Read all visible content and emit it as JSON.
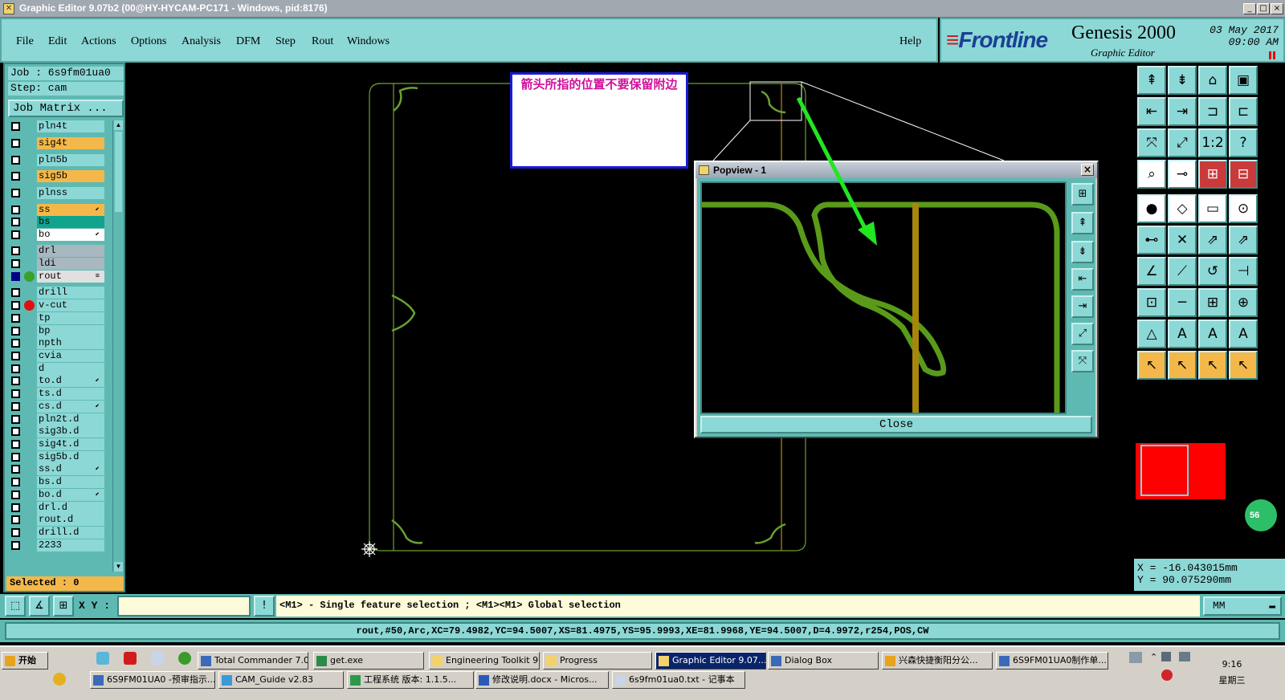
{
  "window": {
    "title": "Graphic Editor 9.07b2 (00@HY-HYCAM-PC171 - Windows, pid:8176)",
    "minimize": "_",
    "maximize": "□",
    "close": "×"
  },
  "menu": [
    "File",
    "Edit",
    "Actions",
    "Options",
    "Analysis",
    "DFM",
    "Step",
    "Rout",
    "Windows"
  ],
  "help": "Help",
  "brand": {
    "logo": "Frontline",
    "product": "Genesis 2000",
    "subtitle": "Graphic Editor",
    "date": "03 May 2017",
    "time": "09:00 AM"
  },
  "job": {
    "job_line": "Job : 6s9fm01ua0",
    "step_line": "Step: cam",
    "matrix_label": "Job Matrix ..."
  },
  "layers": [
    {
      "name": "pln4t",
      "color": "#8cd8d6",
      "dot": "",
      "tag": ""
    },
    {
      "name": "sig4t",
      "color": "#f4b84a",
      "dot": "",
      "tag": ""
    },
    {
      "name": "pln5b",
      "color": "#8cd8d6",
      "dot": "",
      "tag": ""
    },
    {
      "name": "sig5b",
      "color": "#f4b84a",
      "dot": "",
      "tag": ""
    },
    {
      "name": "plnss",
      "color": "#8cd8d6",
      "dot": "",
      "tag": ""
    },
    {
      "name": "ss",
      "color": "#f4b84a",
      "dot": "",
      "tag": "⬋"
    },
    {
      "name": "bs",
      "color": "#12a38d",
      "dot": "",
      "tag": ""
    },
    {
      "name": "bo",
      "color": "#ffffff",
      "dot": "",
      "tag": "⬋"
    },
    {
      "name": "drl",
      "color": "#a8b8c0",
      "dot": "",
      "tag": ""
    },
    {
      "name": "ldi",
      "color": "#a8b8c0",
      "dot": "",
      "tag": ""
    },
    {
      "name": "rout",
      "color": "#e0e0e0",
      "dot": "#3aa02a",
      "tag": "≡",
      "active": true
    },
    {
      "name": "drill",
      "color": "#8cd8d6",
      "dot": "",
      "tag": ""
    },
    {
      "name": "v-cut",
      "color": "#8cd8d6",
      "dot": "#e01010",
      "tag": ""
    },
    {
      "name": "tp",
      "color": "#8cd8d6",
      "dot": "",
      "tag": ""
    },
    {
      "name": "bp",
      "color": "#8cd8d6",
      "dot": "",
      "tag": ""
    },
    {
      "name": "npth",
      "color": "#8cd8d6",
      "dot": "",
      "tag": ""
    },
    {
      "name": "cvia",
      "color": "#8cd8d6",
      "dot": "",
      "tag": ""
    },
    {
      "name": "d",
      "color": "#8cd8d6",
      "dot": "",
      "tag": ""
    },
    {
      "name": "to.d",
      "color": "#8cd8d6",
      "dot": "",
      "tag": "⬋"
    },
    {
      "name": "ts.d",
      "color": "#8cd8d6",
      "dot": "",
      "tag": ""
    },
    {
      "name": "cs.d",
      "color": "#8cd8d6",
      "dot": "",
      "tag": "⬋"
    },
    {
      "name": "pln2t.d",
      "color": "#8cd8d6",
      "dot": "",
      "tag": ""
    },
    {
      "name": "sig3b.d",
      "color": "#8cd8d6",
      "dot": "",
      "tag": ""
    },
    {
      "name": "sig4t.d",
      "color": "#8cd8d6",
      "dot": "",
      "tag": ""
    },
    {
      "name": "sig5b.d",
      "color": "#8cd8d6",
      "dot": "",
      "tag": ""
    },
    {
      "name": "ss.d",
      "color": "#8cd8d6",
      "dot": "",
      "tag": "⬋"
    },
    {
      "name": "bs.d",
      "color": "#8cd8d6",
      "dot": "",
      "tag": ""
    },
    {
      "name": "bo.d",
      "color": "#8cd8d6",
      "dot": "",
      "tag": "⬋"
    },
    {
      "name": "drl.d",
      "color": "#8cd8d6",
      "dot": "",
      "tag": ""
    },
    {
      "name": "rout.d",
      "color": "#8cd8d6",
      "dot": "",
      "tag": ""
    },
    {
      "name": "drill.d",
      "color": "#8cd8d6",
      "dot": "",
      "tag": ""
    },
    {
      "name": "2233",
      "color": "#8cd8d6",
      "dot": "",
      "tag": ""
    }
  ],
  "selected": "Selected : 0",
  "annotation": "箭头所指的位置不要保留附边",
  "popview": {
    "title": "Popview - 1",
    "close_label": "Close",
    "close_x": "×"
  },
  "tools": [
    "⇞",
    "⇟",
    "⌂",
    "▣",
    "⇤",
    "⇥",
    "⊐",
    "⊏",
    "⤧",
    "⤢",
    "1:2",
    "?",
    "⌕",
    "⊸",
    "⊞",
    "⊟",
    "●",
    "◇",
    "▭",
    "⊙",
    "⊷",
    "✕",
    "⇗",
    "⇗",
    "∠",
    "⟋",
    "↺",
    "⊣",
    "⊡",
    "─",
    "⊞",
    "⊕",
    "△",
    "A",
    "A",
    "A",
    "↖",
    "↖",
    "↖",
    "↖"
  ],
  "coords": {
    "x": "X  = -16.043015mm",
    "y": "Y  = 90.075290mm"
  },
  "badge": "56",
  "cmd": {
    "xy_label": "X Y :",
    "xy_value": "",
    "message": "<M1> - Single feature selection ; <M1><M1> Global selection",
    "unit": "MM"
  },
  "feature_info": "rout,#50,Arc,XC=79.4982,YC=94.5007,XS=81.4975,YS=95.9993,XE=81.9968,YE=94.5007,D=4.9972,r254,POS,CW",
  "taskbar": {
    "start": "开始",
    "row1": [
      "Total Commander 7.0...",
      "get.exe",
      "Engineering Toolkit 9....",
      "Progress",
      "Graphic Editor 9.07...",
      "Dialog Box",
      "兴森快捷衡阳分公...",
      "6S9FM01UA0制作单..."
    ],
    "row2": [
      "6S9FM01UA0 -预审指示...",
      "CAM_Guide v2.83",
      "工程系统  版本: 1.1.5...",
      "修改说明.docx - Micros...",
      "6s9fm01ua0.txt - 记事本"
    ],
    "time": "9:16",
    "day": "星期三"
  }
}
